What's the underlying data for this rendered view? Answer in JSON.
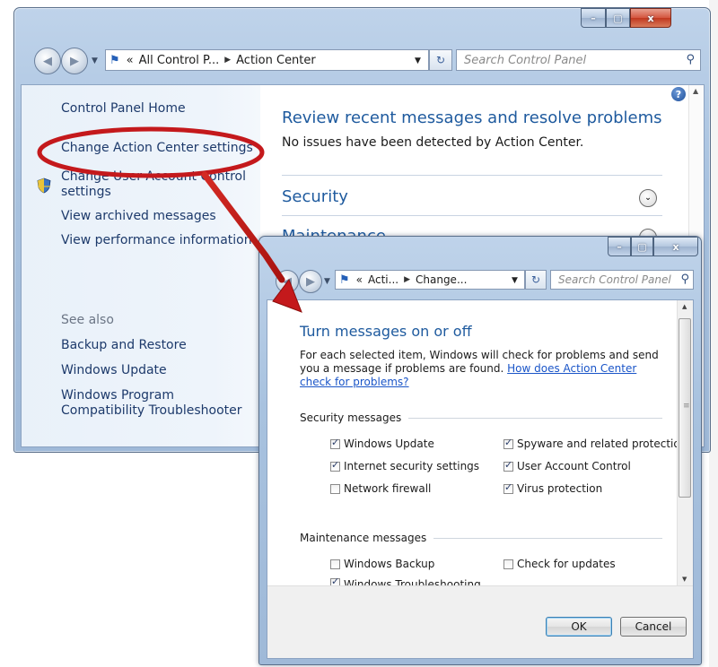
{
  "window1": {
    "address": {
      "chevrons": "«",
      "crumb1": "All Control P...",
      "crumb2": "Action Center"
    },
    "search_placeholder": "Search Control Panel",
    "caption": {
      "minimize": "–",
      "maximize": "▢",
      "close": "x"
    },
    "left_pane": {
      "home": "Control Panel Home",
      "change_settings": "Change Action Center settings",
      "change_uac_line1": "Change User Account Control",
      "change_uac_line2": "settings",
      "view_archived": "View archived messages",
      "view_performance": "View performance information",
      "see_also": "See also",
      "backup": "Backup and Restore",
      "windows_update": "Windows Update",
      "compat_line1": "Windows Program",
      "compat_line2": "Compatibility Troubleshooter"
    },
    "main": {
      "title": "Review recent messages and resolve problems",
      "subtitle": "No issues have been detected by Action Center.",
      "section_security": "Security",
      "section_maintenance": "Maintenance"
    }
  },
  "window2": {
    "address": {
      "chevrons": "«",
      "crumb1": "Acti...",
      "crumb2": "Change..."
    },
    "search_placeholder": "Search Control Panel",
    "caption": {
      "minimize": "–",
      "maximize": "▢",
      "close": "x"
    },
    "title": "Turn messages on or off",
    "desc": "For each selected item, Windows will check for problems and send you a message if problems are found.",
    "desc_link": "How does Action Center check for problems?",
    "security_group": "Security messages",
    "security_items": [
      {
        "label": "Windows Update",
        "checked": true
      },
      {
        "label": "Spyware and related protection",
        "checked": true
      },
      {
        "label": "Internet security settings",
        "checked": true
      },
      {
        "label": "User Account Control",
        "checked": true
      },
      {
        "label": "Network firewall",
        "checked": false
      },
      {
        "label": "Virus protection",
        "checked": true
      }
    ],
    "maintenance_group": "Maintenance messages",
    "maintenance_items": [
      {
        "label": "Windows Backup",
        "checked": false
      },
      {
        "label": "Check for updates",
        "checked": false
      },
      {
        "label": "Windows Troubleshooting",
        "checked": true
      }
    ],
    "ok": "OK",
    "cancel": "Cancel"
  },
  "colors": {
    "annotation_red": "#c4191c",
    "link_blue": "#1e5a9e",
    "frame_blue": "#a8c2df"
  }
}
